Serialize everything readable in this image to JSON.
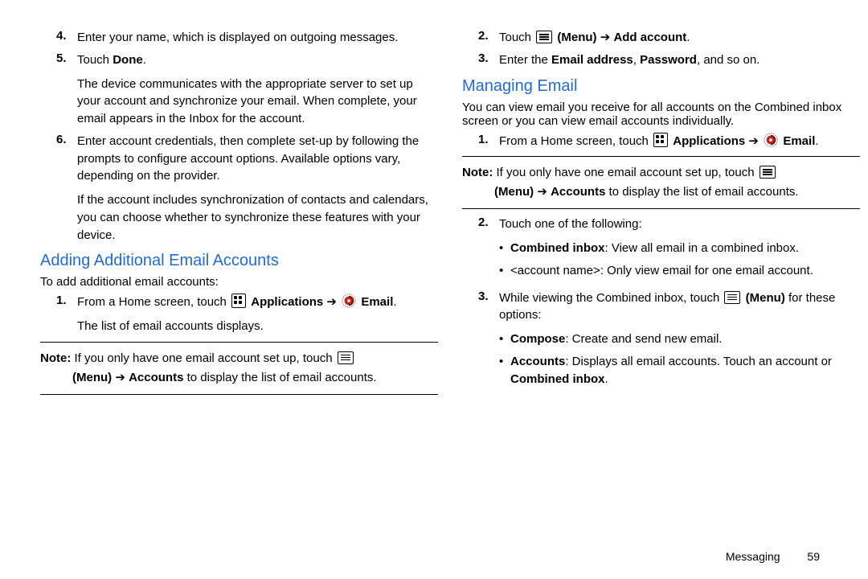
{
  "left": {
    "steps1": [
      {
        "n": "4.",
        "paras": [
          [
            {
              "t": "Enter your name, which is displayed on outgoing messages."
            }
          ]
        ]
      },
      {
        "n": "5.",
        "paras": [
          [
            {
              "t": "Touch "
            },
            {
              "t": "Done",
              "b": true
            },
            {
              "t": "."
            }
          ],
          [
            {
              "t": "The device communicates with the appropriate server to set up your account and synchronize your email. When complete, your email appears in the Inbox for the account."
            }
          ]
        ]
      },
      {
        "n": "6.",
        "paras": [
          [
            {
              "t": "Enter account credentials, then complete set-up by following the prompts to configure account options. Available options vary, depending on the provider."
            }
          ],
          [
            {
              "t": "If the account includes synchronization of contacts and calendars, you can choose whether to synchronize these features with your device."
            }
          ]
        ]
      }
    ],
    "heading": "Adding Additional Email Accounts",
    "intro": "To add additional email accounts:",
    "steps2": [
      {
        "n": "1.",
        "paras": [
          [
            {
              "t": "From a Home screen, touch "
            },
            {
              "icon": "apps"
            },
            {
              "t": " "
            },
            {
              "t": "Applications",
              "b": true
            },
            {
              "t": " ➔ "
            },
            {
              "icon": "email"
            },
            {
              "t": " "
            },
            {
              "t": "Email",
              "b": true
            },
            {
              "t": "."
            }
          ],
          [
            {
              "t": "The list of email accounts displays."
            }
          ]
        ]
      }
    ],
    "note": {
      "label": "Note:",
      "line1": [
        {
          "t": " If you only have one email account set up, touch "
        },
        {
          "icon": "menu"
        }
      ],
      "line2": [
        {
          "t": "(Menu)",
          "b": true
        },
        {
          "t": " ➔ "
        },
        {
          "t": "Accounts",
          "b": true
        },
        {
          "t": " to display the list of email accounts."
        }
      ]
    }
  },
  "right": {
    "steps1": [
      {
        "n": "2.",
        "paras": [
          [
            {
              "t": "Touch "
            },
            {
              "icon": "menu"
            },
            {
              "t": " "
            },
            {
              "t": "(Menu)",
              "b": true
            },
            {
              "t": " ➔ "
            },
            {
              "t": "Add account",
              "b": true
            },
            {
              "t": "."
            }
          ]
        ]
      },
      {
        "n": "3.",
        "paras": [
          [
            {
              "t": "Enter the "
            },
            {
              "t": "Email address",
              "b": true
            },
            {
              "t": ", "
            },
            {
              "t": "Password",
              "b": true
            },
            {
              "t": ", and so on."
            }
          ]
        ]
      }
    ],
    "heading": "Managing Email",
    "intro": "You can view email you receive for all accounts on the Combined inbox screen or you can view email accounts individually.",
    "steps2": [
      {
        "n": "1.",
        "paras": [
          [
            {
              "t": "From a Home screen, touch "
            },
            {
              "icon": "apps"
            },
            {
              "t": " "
            },
            {
              "t": "Applications",
              "b": true
            },
            {
              "t": " ➔ "
            },
            {
              "icon": "email"
            },
            {
              "t": " "
            },
            {
              "t": "Email",
              "b": true
            },
            {
              "t": "."
            }
          ]
        ]
      }
    ],
    "note": {
      "label": "Note:",
      "line1": [
        {
          "t": " If you only have one email account set up, touch "
        },
        {
          "icon": "menu"
        }
      ],
      "line2": [
        {
          "t": "(Menu)",
          "b": true
        },
        {
          "t": " ➔ "
        },
        {
          "t": "Accounts",
          "b": true
        },
        {
          "t": " to display the list of email accounts."
        }
      ]
    },
    "steps3": [
      {
        "n": "2.",
        "paras": [
          [
            {
              "t": "Touch one of the following:"
            }
          ]
        ],
        "bullets": [
          [
            {
              "t": "Combined inbox",
              "b": true
            },
            {
              "t": ": View all email in a combined inbox."
            }
          ],
          [
            {
              "t": "<account name>: Only view email for one email account."
            }
          ]
        ]
      },
      {
        "n": "3.",
        "paras": [
          [
            {
              "t": "While viewing the Combined inbox, touch "
            },
            {
              "icon": "menu"
            },
            {
              "t": " "
            },
            {
              "t": "(Menu)",
              "b": true
            },
            {
              "t": " for these options:"
            }
          ]
        ],
        "bullets": [
          [
            {
              "t": "Compose",
              "b": true
            },
            {
              "t": ": Create and send new email."
            }
          ],
          [
            {
              "t": "Accounts",
              "b": true
            },
            {
              "t": ": Displays all email accounts. Touch an account or "
            },
            {
              "t": "Combined inbox",
              "b": true
            },
            {
              "t": "."
            }
          ]
        ]
      }
    ]
  },
  "footer": {
    "section": "Messaging",
    "page": "59"
  }
}
